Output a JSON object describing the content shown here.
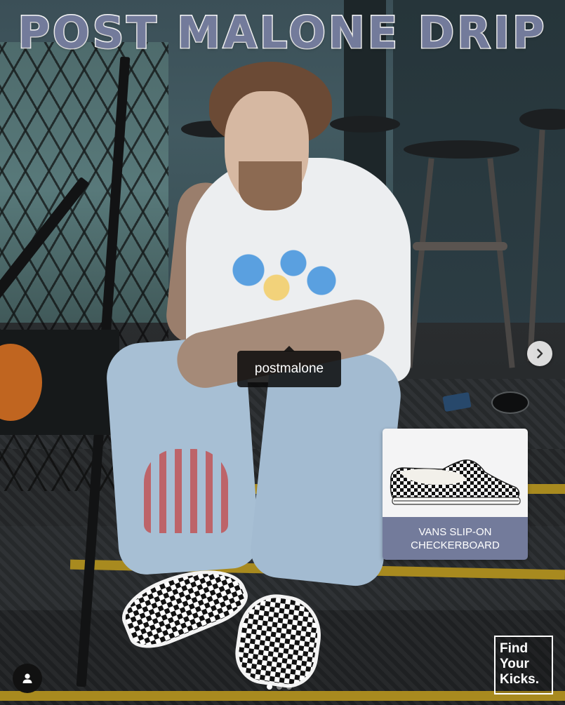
{
  "post": {
    "headline": "POST MALONE DRIP",
    "tag_username": "postmalone",
    "product": {
      "name": "VANS SLIP-ON\nCHECKERBOARD"
    },
    "brand": {
      "line1": "Find",
      "line2": "Your",
      "line3": "Kicks."
    },
    "carousel": {
      "total_slides": 3,
      "current_slide": 1
    },
    "icons": {
      "next": "chevron-right-icon",
      "user": "person-icon"
    },
    "colors": {
      "headline_fill": "#737b9b",
      "headline_stroke": "#ffffff",
      "product_label_bg": "#737b9b",
      "tag_bg": "#0a0a0a"
    }
  }
}
